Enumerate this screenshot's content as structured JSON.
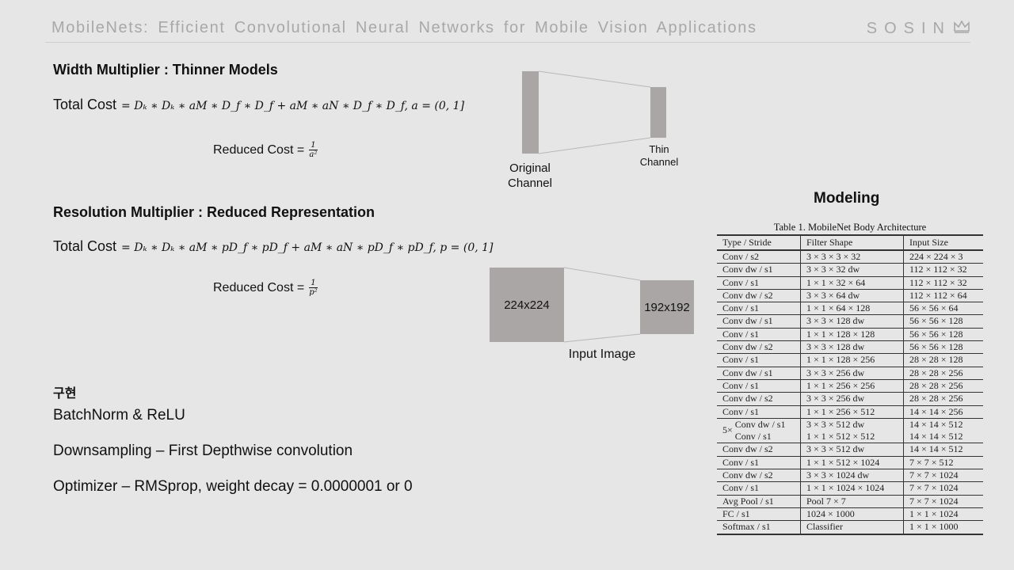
{
  "header": {
    "title": "MobileNets: Efficient Convolutional Neural Networks for Mobile Vision Applications",
    "brand": "SOSIN",
    "brand_icon": "crown-icon"
  },
  "width_section": {
    "heading": "Width Multiplier : Thinner Models",
    "total_cost_label": "Total Cost",
    "total_cost_formula": "= Dₖ ∗ Dₖ ∗ aM ∗ D_f ∗ D_f + aM ∗ aN ∗ D_f ∗ D_f,   a = (0, 1]",
    "reduced_cost_label": "Reduced Cost =",
    "reduced_num": "1",
    "reduced_den": "a²",
    "diagram": {
      "original_label_line1": "Original",
      "original_label_line2": "Channel",
      "thin_label_line1": "Thin",
      "thin_label_line2": "Channel"
    }
  },
  "resolution_section": {
    "heading": "Resolution Multiplier : Reduced Representation",
    "total_cost_label": "Total Cost",
    "total_cost_formula": "= Dₖ ∗ Dₖ ∗ aM ∗ pD_f ∗ pD_f + aM ∗ aN ∗ pD_f ∗ pD_f,   p = (0, 1]",
    "reduced_cost_label": "Reduced Cost =",
    "reduced_num": "1",
    "reduced_den": "p²",
    "diagram": {
      "large_label": "224x224",
      "small_label": "192x192",
      "caption": "Input Image"
    }
  },
  "implementation": {
    "heading": "구현",
    "lines": [
      "BatchNorm & ReLU",
      "Downsampling – First Depthwise convolution",
      "Optimizer – RMSprop, weight decay  =  0.0000001  or  0"
    ]
  },
  "modeling": {
    "title": "Modeling",
    "table_caption": "Table 1. MobileNet Body Architecture",
    "columns": [
      "Type / Stride",
      "Filter Shape",
      "Input Size"
    ],
    "rows_top": [
      [
        "Conv / s2",
        "3 × 3 × 3 × 32",
        "224 × 224 × 3"
      ],
      [
        "Conv dw / s1",
        "3 × 3 × 32 dw",
        "112 × 112 × 32"
      ],
      [
        "Conv / s1",
        "1 × 1 × 32 × 64",
        "112 × 112 × 32"
      ],
      [
        "Conv dw / s2",
        "3 × 3 × 64 dw",
        "112 × 112 × 64"
      ],
      [
        "Conv / s1",
        "1 × 1 × 64 × 128",
        "56 × 56 × 64"
      ],
      [
        "Conv dw / s1",
        "3 × 3 × 128 dw",
        "56 × 56 × 128"
      ],
      [
        "Conv / s1",
        "1 × 1 × 128 × 128",
        "56 × 56 × 128"
      ],
      [
        "Conv dw / s2",
        "3 × 3 × 128 dw",
        "56 × 56 × 128"
      ],
      [
        "Conv / s1",
        "1 × 1 × 128 × 256",
        "28 × 28 × 128"
      ],
      [
        "Conv dw / s1",
        "3 × 3 × 256 dw",
        "28 × 28 × 256"
      ],
      [
        "Conv / s1",
        "1 × 1 × 256 × 256",
        "28 × 28 × 256"
      ],
      [
        "Conv dw / s2",
        "3 × 3 × 256 dw",
        "28 × 28 × 256"
      ],
      [
        "Conv / s1",
        "1 × 1 × 256 × 512",
        "14 × 14 × 256"
      ]
    ],
    "repeat_group": {
      "multiplier": "5×",
      "rows": [
        [
          "Conv dw / s1",
          "3 × 3 × 512 dw",
          "14 × 14 × 512"
        ],
        [
          "Conv / s1",
          "1 × 1 × 512 × 512",
          "14 × 14 × 512"
        ]
      ]
    },
    "rows_bottom": [
      [
        "Conv dw / s2",
        "3 × 3 × 512 dw",
        "14 × 14 × 512"
      ],
      [
        "Conv / s1",
        "1 × 1 × 512 × 1024",
        "7 × 7 × 512"
      ],
      [
        "Conv dw / s2",
        "3 × 3 × 1024 dw",
        "7 × 7 × 1024"
      ],
      [
        "Conv / s1",
        "1 × 1 × 1024 × 1024",
        "7 × 7 × 1024"
      ],
      [
        "Avg Pool / s1",
        "Pool 7 × 7",
        "7 × 7 × 1024"
      ],
      [
        "FC / s1",
        "1024 × 1000",
        "1 × 1 × 1024"
      ],
      [
        "Softmax / s1",
        "Classifier",
        "1 × 1 × 1000"
      ]
    ]
  }
}
